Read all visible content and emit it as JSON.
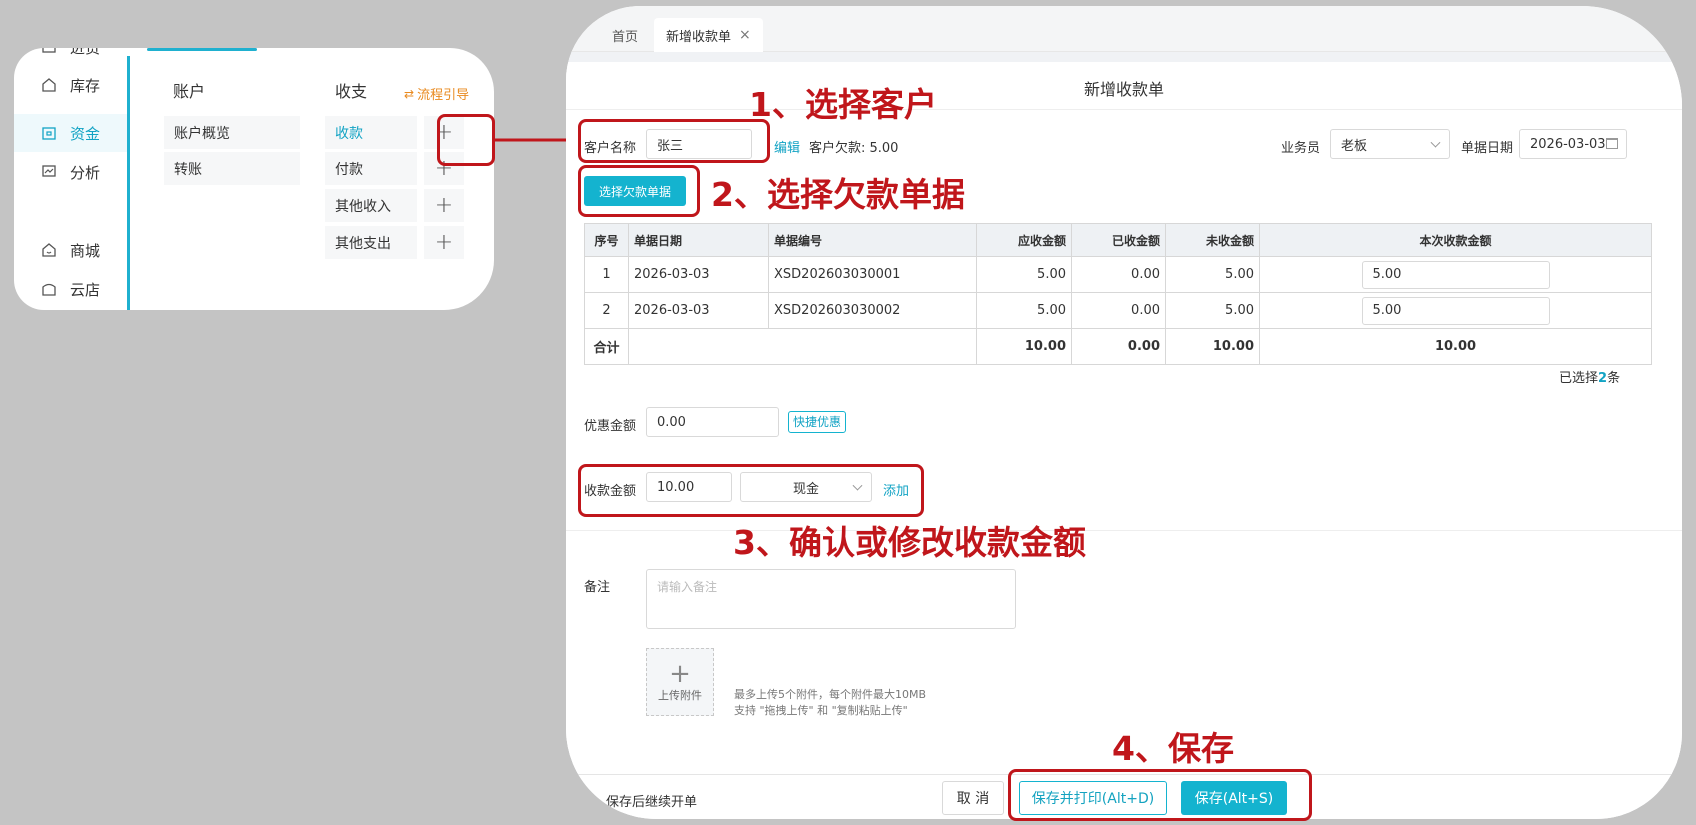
{
  "left_panel": {
    "sidebar": [
      {
        "label": "进货",
        "icon": "truck-icon"
      },
      {
        "label": "库存",
        "icon": "home-icon"
      },
      {
        "label": "资金",
        "icon": "wallet-icon",
        "active": true
      },
      {
        "label": "分析",
        "icon": "chart-icon"
      },
      {
        "label": "商城",
        "icon": "store-icon"
      },
      {
        "label": "云店",
        "icon": "shop-icon"
      }
    ],
    "account_header": "账户",
    "account_items": [
      "账户概览",
      "转账"
    ],
    "income_header": "收支",
    "flow_guide": "流程引导",
    "income_items": [
      "收款",
      "付款",
      "其他收入",
      "其他支出"
    ]
  },
  "tabs": {
    "home": "首页",
    "current": "新增收款单"
  },
  "form": {
    "title": "新增收款单",
    "customer_label": "客户名称",
    "customer_value": "张三",
    "edit_link": "编辑",
    "debt_text": "客户欠款: 5.00",
    "salesperson_label": "业务员",
    "salesperson_value": "老板",
    "date_label": "单据日期",
    "date_value": "2026-03-03",
    "select_debt_button": "选择欠款单据",
    "table": {
      "headers": [
        "序号",
        "单据日期",
        "单据编号",
        "应收金额",
        "已收金额",
        "未收金额",
        "本次收款金额"
      ],
      "rows": [
        {
          "idx": "1",
          "date": "2026-03-03",
          "no": "XSD202603030001",
          "receivable": "5.00",
          "received": "0.00",
          "unpaid": "5.00",
          "this_time": "5.00"
        },
        {
          "idx": "2",
          "date": "2026-03-03",
          "no": "XSD202603030002",
          "receivable": "5.00",
          "received": "0.00",
          "unpaid": "5.00",
          "this_time": "5.00"
        }
      ],
      "total": {
        "label": "合计",
        "receivable": "10.00",
        "received": "0.00",
        "unpaid": "10.00",
        "this_time": "10.00"
      }
    },
    "selected_prefix": "已选择",
    "selected_count": "2",
    "selected_suffix": "条",
    "discount_label": "优惠金额",
    "discount_value": "0.00",
    "quick_discount": "快捷优惠",
    "amount_label": "收款金额",
    "amount_value": "10.00",
    "method_value": "现金",
    "add_link": "添加",
    "remark_label": "备注",
    "remark_placeholder": "请输入备注",
    "upload_label": "上传附件",
    "upload_hint1": "最多上传5个附件，每个附件最大10MB",
    "upload_hint2": "支持 \"拖拽上传\" 和 \"复制粘贴上传\""
  },
  "footer": {
    "continue_label": "保存后继续开单",
    "cancel": "取 消",
    "save_print": "保存并打印(Alt+D)",
    "save": "保存(Alt+S)"
  },
  "annotations": {
    "step1": "1、选择客户",
    "step2": "2、选择欠款单据",
    "step3": "3、确认或修改收款金额",
    "step4": "4、保存"
  },
  "colors": {
    "accent": "#14b3cf",
    "annotation_red": "#c0161b",
    "flow_orange": "#e98a1f"
  }
}
